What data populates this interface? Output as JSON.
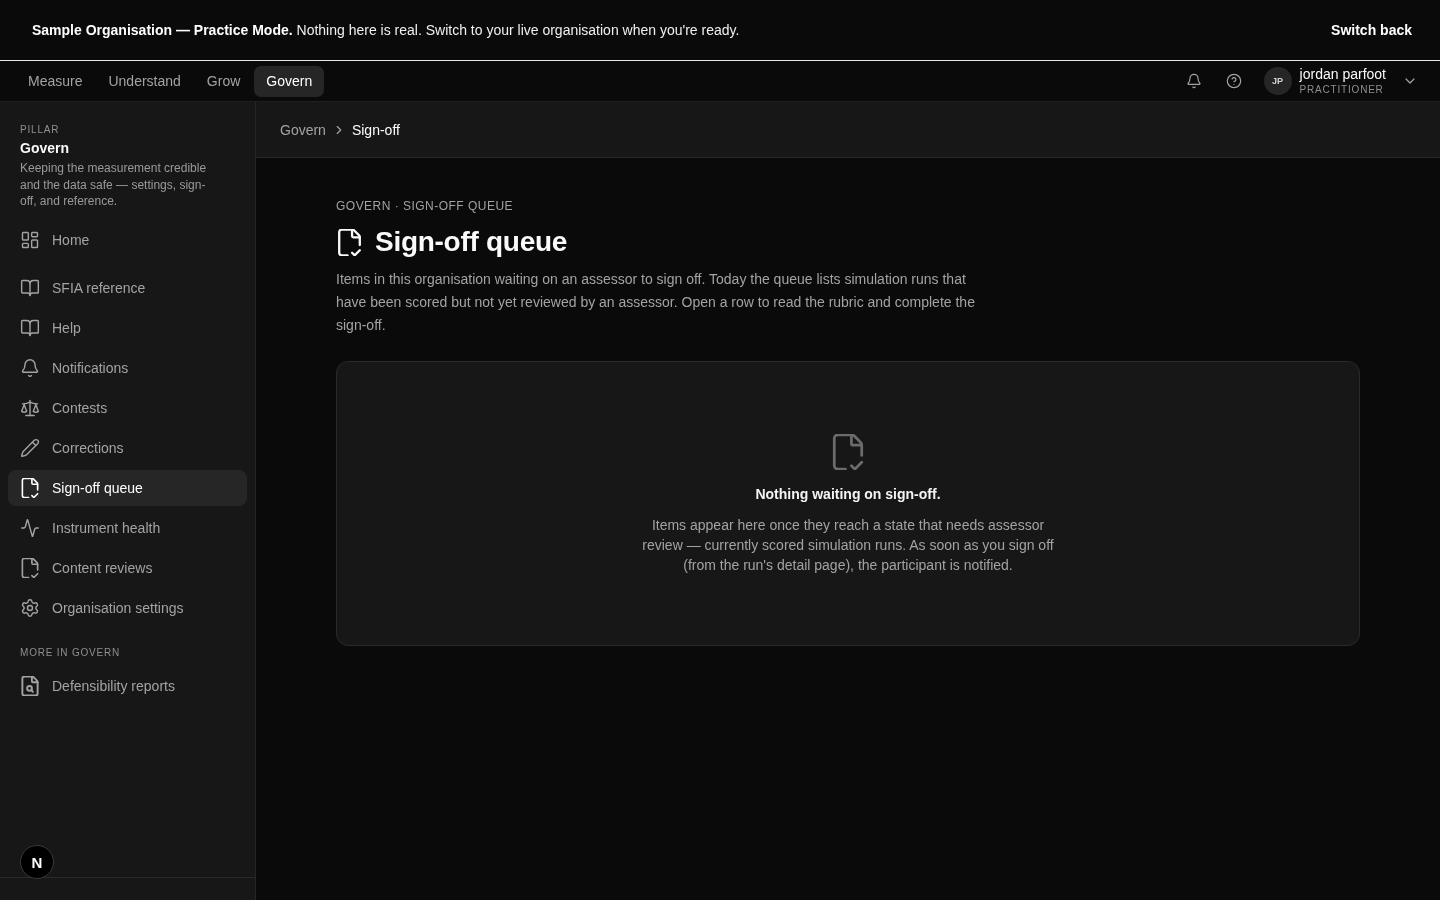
{
  "banner": {
    "message": "**Sample Organisation — Practice Mode.** Nothing here is real. Switch to your live organisation when you're ready.",
    "action": "Switch back"
  },
  "top_nav": {
    "tabs": [
      {
        "label": "Measure",
        "selected": false
      },
      {
        "label": "Understand",
        "selected": false
      },
      {
        "label": "Grow",
        "selected": false
      },
      {
        "label": "Govern",
        "selected": true
      }
    ]
  },
  "user": {
    "initials": "JP",
    "name": "jordan parfoot",
    "role": "PRACTITIONER"
  },
  "sidebar": {
    "eyebrow": "PILLAR",
    "title": "Govern",
    "description": "Keeping the measurement credible and the data safe — settings, sign-off, and reference.",
    "sections": [
      {
        "items": [
          {
            "label": "Home",
            "selected": false
          }
        ]
      },
      {
        "items": [
          {
            "label": "SFIA reference",
            "selected": false
          },
          {
            "label": "Help",
            "selected": false
          },
          {
            "label": "Notifications",
            "selected": false
          },
          {
            "label": "Contests",
            "selected": false
          },
          {
            "label": "Corrections",
            "selected": false
          },
          {
            "label": "Sign-off queue",
            "selected": true
          },
          {
            "label": "Instrument health",
            "selected": false
          },
          {
            "label": "Content reviews",
            "selected": false
          },
          {
            "label": "Organisation settings",
            "selected": false
          }
        ]
      },
      {
        "heading": "MORE IN GOVERN",
        "items": [
          {
            "label": "Defensibility reports",
            "selected": false
          }
        ]
      }
    ]
  },
  "breadcrumb": [
    {
      "label": "Govern",
      "current": false
    },
    {
      "label": "Sign-off",
      "current": true
    }
  ],
  "page": {
    "eyebrow": "GOVERN · SIGN-OFF QUEUE",
    "title": "Sign-off queue",
    "description": "Items in this organisation waiting on an assessor to sign off. Today the queue lists simulation runs that have been scored but not yet reviewed by an assessor. Open a row to read the rubric and complete the sign-off.",
    "empty_state": {
      "title": "Nothing waiting on sign-off.",
      "body": "Items appear here once they reach a state that needs assessor review — currently scored simulation runs. As soon as you sign off (from the run's detail page), the participant is notified."
    }
  },
  "dev_tools": {
    "label": "N"
  }
}
